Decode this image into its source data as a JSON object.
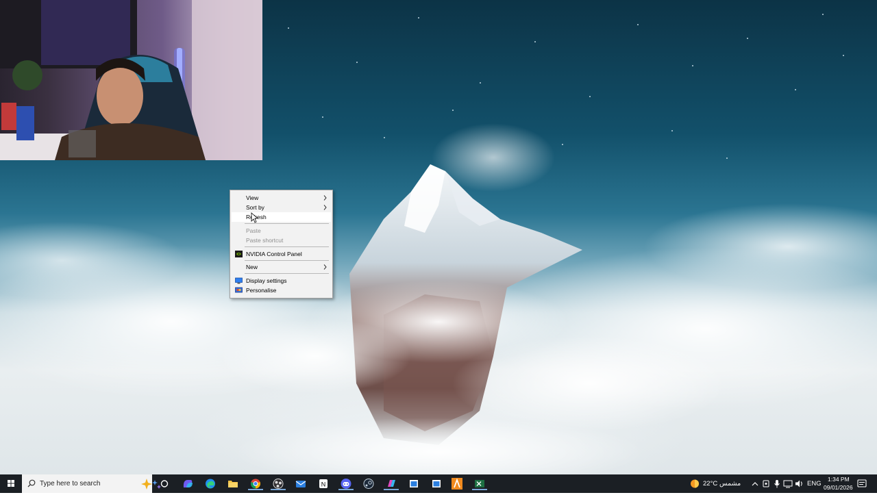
{
  "context_menu": {
    "items": [
      {
        "label": "View",
        "submenu": true,
        "enabled": true
      },
      {
        "label": "Sort by",
        "submenu": true,
        "enabled": true
      },
      {
        "label": "Refresh",
        "submenu": false,
        "enabled": true
      },
      {
        "label": "Paste",
        "submenu": false,
        "enabled": false
      },
      {
        "label": "Paste shortcut",
        "submenu": false,
        "enabled": false
      },
      {
        "label": "NVIDIA Control Panel",
        "icon": "nvidia-icon",
        "enabled": true
      },
      {
        "label": "New",
        "submenu": true,
        "enabled": true
      },
      {
        "label": "Display settings",
        "icon": "display-icon",
        "enabled": true
      },
      {
        "label": "Personalise",
        "icon": "personalise-icon",
        "enabled": true
      }
    ]
  },
  "taskbar": {
    "search_placeholder": "Type here to search",
    "apps": [
      "cortana-icon",
      "copilot-icon",
      "edge-icon",
      "file-explorer-icon",
      "chrome-icon",
      "obs-icon",
      "mail-icon",
      "notion-icon",
      "discord-icon",
      "steam-icon",
      "microsoft365-icon",
      "window-app-icon",
      "window-app-icon",
      "editor-app-icon",
      "excel-icon"
    ],
    "weather": {
      "temp": "22°C",
      "condition": "مشمس"
    },
    "language": "ENG",
    "time": "1:34 PM",
    "date": "09/01/2026"
  },
  "colors": {
    "taskbar_bg": "#1b1f24",
    "menu_bg": "#f2f2f2",
    "accent": "#2f7ff0"
  }
}
